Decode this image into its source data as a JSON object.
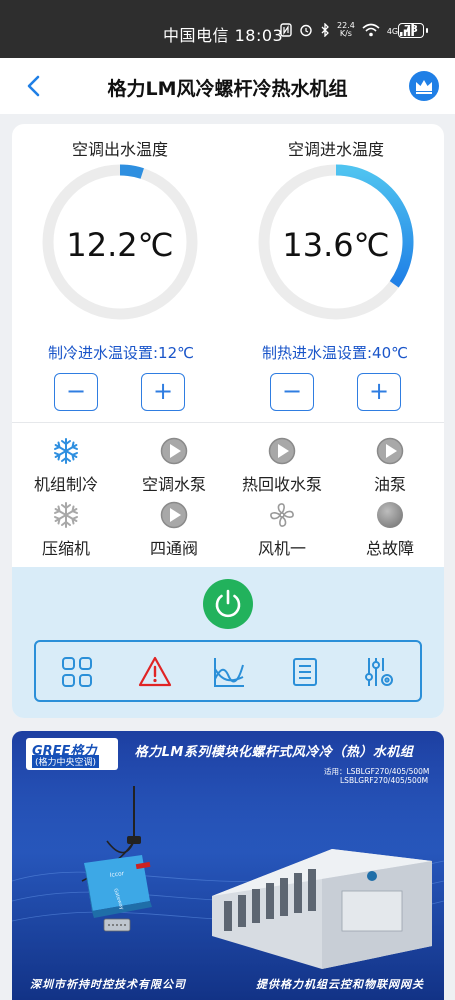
{
  "status_bar": {
    "carrier_time": "中国电信 18:03",
    "net_speed": "22.4",
    "net_unit": "K/s",
    "signal": "4G",
    "battery": "73"
  },
  "header": {
    "title": "格力LM风冷螺杆冷热水机组"
  },
  "gauges": [
    {
      "title": "空调出水温度",
      "value": "12.2℃",
      "level": 0.05,
      "color": "#2e8fe0"
    },
    {
      "title": "空调进水温度",
      "value": "13.6℃",
      "level": 0.35,
      "color": "#2e8fe0"
    }
  ],
  "settings": {
    "cooling": "制冷进水温设置:12℃",
    "heating": "制热进水温设置:40℃",
    "minus": "−",
    "plus": "+"
  },
  "status_items": [
    {
      "label": "机组制冷",
      "icon": "snowflake-icon",
      "active": true
    },
    {
      "label": "空调水泵",
      "icon": "play-icon",
      "active": false
    },
    {
      "label": "热回收水泵",
      "icon": "play-icon",
      "active": false
    },
    {
      "label": "油泵",
      "icon": "play-icon",
      "active": false
    },
    {
      "label": "压缩机",
      "icon": "snowflake-icon",
      "active": false
    },
    {
      "label": "四通阀",
      "icon": "play-icon",
      "active": false
    },
    {
      "label": "风机一",
      "icon": "fan-icon",
      "active": false
    },
    {
      "label": "总故障",
      "icon": "fault-indicator-icon",
      "active": false
    }
  ],
  "colors": {
    "accent": "#2e8fe0",
    "power": "#22b25c",
    "warning": "#e02424",
    "setting_text": "#1a55c9"
  },
  "banner": {
    "logo": "GREE格力",
    "logo_sub": "(格力中央空调)",
    "title": "格力LM系列模块化螺杆式风冷冷（热）水机组",
    "models_line1": "适用：LSBLGF270/405/500M",
    "models_line2": "LSBLGRF270/405/500M",
    "footer_left": "深圳市祈持时控技术有限公司",
    "footer_right": "提供格力机组云控和物联网网关",
    "device_label": "Gateway",
    "device_brand": "Iccor"
  }
}
